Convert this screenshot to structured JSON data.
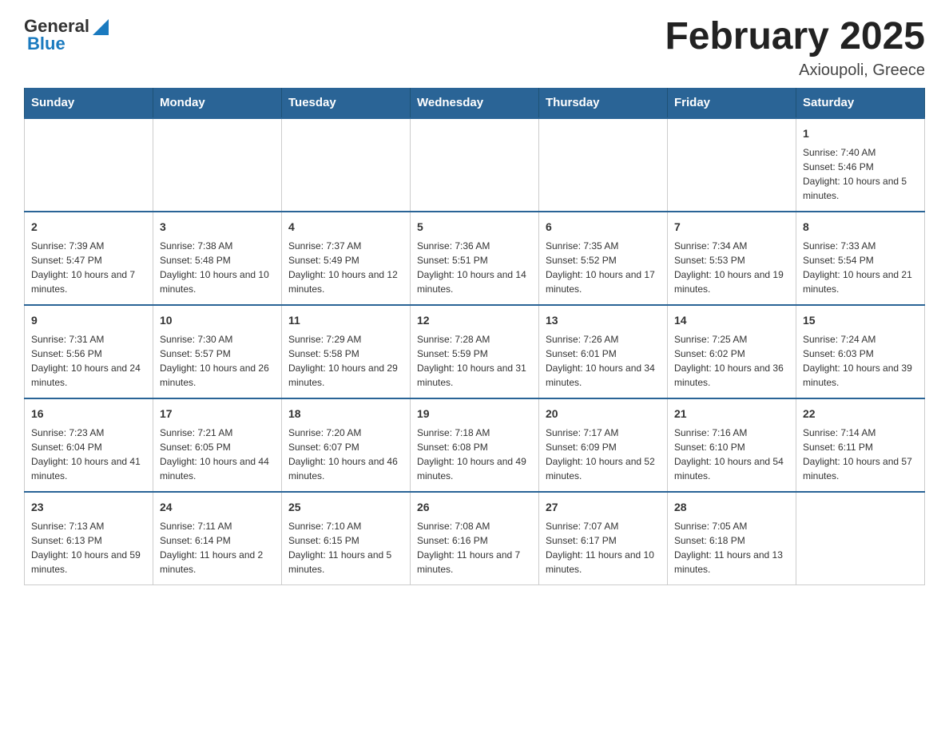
{
  "header": {
    "logo_general": "General",
    "logo_blue": "Blue",
    "month_title": "February 2025",
    "location": "Axioupoli, Greece"
  },
  "days_of_week": [
    "Sunday",
    "Monday",
    "Tuesday",
    "Wednesday",
    "Thursday",
    "Friday",
    "Saturday"
  ],
  "weeks": [
    [
      {
        "day": "",
        "info": ""
      },
      {
        "day": "",
        "info": ""
      },
      {
        "day": "",
        "info": ""
      },
      {
        "day": "",
        "info": ""
      },
      {
        "day": "",
        "info": ""
      },
      {
        "day": "",
        "info": ""
      },
      {
        "day": "1",
        "info": "Sunrise: 7:40 AM\nSunset: 5:46 PM\nDaylight: 10 hours and 5 minutes."
      }
    ],
    [
      {
        "day": "2",
        "info": "Sunrise: 7:39 AM\nSunset: 5:47 PM\nDaylight: 10 hours and 7 minutes."
      },
      {
        "day": "3",
        "info": "Sunrise: 7:38 AM\nSunset: 5:48 PM\nDaylight: 10 hours and 10 minutes."
      },
      {
        "day": "4",
        "info": "Sunrise: 7:37 AM\nSunset: 5:49 PM\nDaylight: 10 hours and 12 minutes."
      },
      {
        "day": "5",
        "info": "Sunrise: 7:36 AM\nSunset: 5:51 PM\nDaylight: 10 hours and 14 minutes."
      },
      {
        "day": "6",
        "info": "Sunrise: 7:35 AM\nSunset: 5:52 PM\nDaylight: 10 hours and 17 minutes."
      },
      {
        "day": "7",
        "info": "Sunrise: 7:34 AM\nSunset: 5:53 PM\nDaylight: 10 hours and 19 minutes."
      },
      {
        "day": "8",
        "info": "Sunrise: 7:33 AM\nSunset: 5:54 PM\nDaylight: 10 hours and 21 minutes."
      }
    ],
    [
      {
        "day": "9",
        "info": "Sunrise: 7:31 AM\nSunset: 5:56 PM\nDaylight: 10 hours and 24 minutes."
      },
      {
        "day": "10",
        "info": "Sunrise: 7:30 AM\nSunset: 5:57 PM\nDaylight: 10 hours and 26 minutes."
      },
      {
        "day": "11",
        "info": "Sunrise: 7:29 AM\nSunset: 5:58 PM\nDaylight: 10 hours and 29 minutes."
      },
      {
        "day": "12",
        "info": "Sunrise: 7:28 AM\nSunset: 5:59 PM\nDaylight: 10 hours and 31 minutes."
      },
      {
        "day": "13",
        "info": "Sunrise: 7:26 AM\nSunset: 6:01 PM\nDaylight: 10 hours and 34 minutes."
      },
      {
        "day": "14",
        "info": "Sunrise: 7:25 AM\nSunset: 6:02 PM\nDaylight: 10 hours and 36 minutes."
      },
      {
        "day": "15",
        "info": "Sunrise: 7:24 AM\nSunset: 6:03 PM\nDaylight: 10 hours and 39 minutes."
      }
    ],
    [
      {
        "day": "16",
        "info": "Sunrise: 7:23 AM\nSunset: 6:04 PM\nDaylight: 10 hours and 41 minutes."
      },
      {
        "day": "17",
        "info": "Sunrise: 7:21 AM\nSunset: 6:05 PM\nDaylight: 10 hours and 44 minutes."
      },
      {
        "day": "18",
        "info": "Sunrise: 7:20 AM\nSunset: 6:07 PM\nDaylight: 10 hours and 46 minutes."
      },
      {
        "day": "19",
        "info": "Sunrise: 7:18 AM\nSunset: 6:08 PM\nDaylight: 10 hours and 49 minutes."
      },
      {
        "day": "20",
        "info": "Sunrise: 7:17 AM\nSunset: 6:09 PM\nDaylight: 10 hours and 52 minutes."
      },
      {
        "day": "21",
        "info": "Sunrise: 7:16 AM\nSunset: 6:10 PM\nDaylight: 10 hours and 54 minutes."
      },
      {
        "day": "22",
        "info": "Sunrise: 7:14 AM\nSunset: 6:11 PM\nDaylight: 10 hours and 57 minutes."
      }
    ],
    [
      {
        "day": "23",
        "info": "Sunrise: 7:13 AM\nSunset: 6:13 PM\nDaylight: 10 hours and 59 minutes."
      },
      {
        "day": "24",
        "info": "Sunrise: 7:11 AM\nSunset: 6:14 PM\nDaylight: 11 hours and 2 minutes."
      },
      {
        "day": "25",
        "info": "Sunrise: 7:10 AM\nSunset: 6:15 PM\nDaylight: 11 hours and 5 minutes."
      },
      {
        "day": "26",
        "info": "Sunrise: 7:08 AM\nSunset: 6:16 PM\nDaylight: 11 hours and 7 minutes."
      },
      {
        "day": "27",
        "info": "Sunrise: 7:07 AM\nSunset: 6:17 PM\nDaylight: 11 hours and 10 minutes."
      },
      {
        "day": "28",
        "info": "Sunrise: 7:05 AM\nSunset: 6:18 PM\nDaylight: 11 hours and 13 minutes."
      },
      {
        "day": "",
        "info": ""
      }
    ]
  ]
}
